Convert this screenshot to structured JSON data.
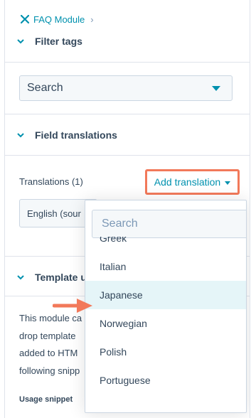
{
  "breadcrumb": {
    "label": "FAQ Module",
    "separator": "›"
  },
  "sections": {
    "filter_tags": {
      "title": "Filter tags"
    },
    "field_translations": {
      "title": "Field translations"
    },
    "template_usage": {
      "title": "Template u"
    }
  },
  "search_select": {
    "value": "Search"
  },
  "translations": {
    "label": "Translations (1)",
    "add_button": "Add translation",
    "current_language": "English (sour"
  },
  "dropdown": {
    "search_placeholder": "Search",
    "options": [
      "Greek",
      "Italian",
      "Japanese",
      "Norwegian",
      "Polish",
      "Portuguese"
    ],
    "highlighted": "Japanese"
  },
  "body_text": {
    "lines": [
      "This module ca",
      "drop template",
      "added to HTM",
      "following snipp"
    ]
  },
  "usage_snippet_label": "Usage snippet",
  "colors": {
    "accent": "#0091ae",
    "highlight_border": "#f2795a",
    "highlight_row": "#e5f5f8",
    "text": "#33475b",
    "border": "#dfe3eb"
  }
}
